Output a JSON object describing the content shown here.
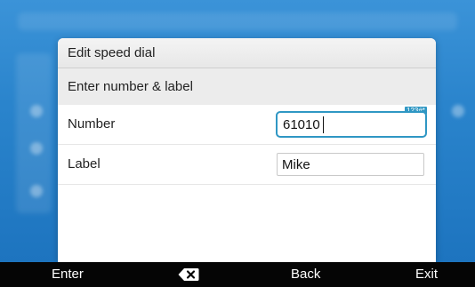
{
  "dialog": {
    "title": "Edit speed dial",
    "subtitle": "Enter number & label"
  },
  "fields": {
    "number": {
      "label": "Number",
      "value": "61010",
      "input_mode": "123#*"
    },
    "label": {
      "label": "Label",
      "value": "Mike"
    }
  },
  "softkeys": {
    "enter": "Enter",
    "backspace_icon": "backspace-icon",
    "back": "Back",
    "exit": "Exit"
  },
  "colors": {
    "accent": "#2f97c4",
    "softkey_bar": "#050505",
    "background": "#2a84cc"
  }
}
